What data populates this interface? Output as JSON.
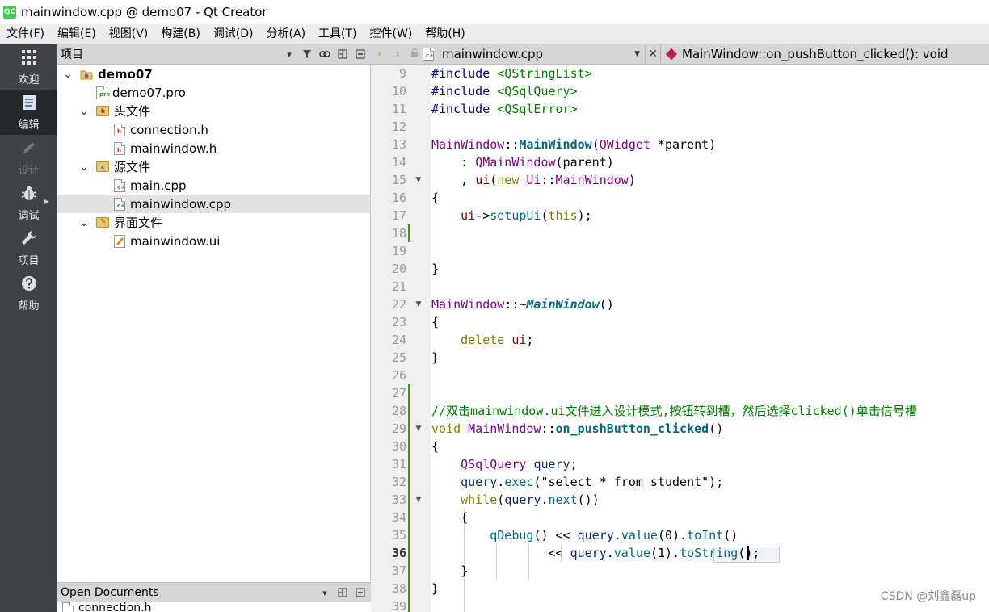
{
  "window": {
    "title": "mainwindow.cpp @ demo07 - Qt Creator",
    "logo": "QC"
  },
  "menu": [
    "文件(F)",
    "编辑(E)",
    "视图(V)",
    "构建(B)",
    "调试(D)",
    "分析(A)",
    "工具(T)",
    "控件(W)",
    "帮助(H)"
  ],
  "modes": [
    {
      "label": "欢迎",
      "icon": "grid-icon",
      "state": "normal"
    },
    {
      "label": "编辑",
      "icon": "document-icon",
      "state": "active"
    },
    {
      "label": "设计",
      "icon": "pencil-icon",
      "state": "disabled"
    },
    {
      "label": "调试",
      "icon": "bug-icon",
      "state": "normal"
    },
    {
      "label": "项目",
      "icon": "wrench-icon",
      "state": "normal"
    },
    {
      "label": "帮助",
      "icon": "help-icon",
      "state": "normal"
    }
  ],
  "project_panel": {
    "title": "项目",
    "tree": [
      {
        "label": "demo07",
        "depth": 0,
        "expanded": true,
        "icon": "project-icon",
        "bold": true
      },
      {
        "label": "demo07.pro",
        "depth": 1,
        "icon": "pro-file-icon",
        "tag": "pro"
      },
      {
        "label": "头文件",
        "depth": 1,
        "expanded": true,
        "icon": "folder-icon",
        "tag": "h"
      },
      {
        "label": "connection.h",
        "depth": 2,
        "icon": "header-file-icon",
        "tag": "h"
      },
      {
        "label": "mainwindow.h",
        "depth": 2,
        "icon": "header-file-icon",
        "tag": "h"
      },
      {
        "label": "源文件",
        "depth": 1,
        "expanded": true,
        "icon": "folder-icon",
        "tag": "c"
      },
      {
        "label": "main.cpp",
        "depth": 2,
        "icon": "cpp-file-icon",
        "tag": "c+"
      },
      {
        "label": "mainwindow.cpp",
        "depth": 2,
        "icon": "cpp-file-icon",
        "tag": "c+",
        "selected": true
      },
      {
        "label": "界面文件",
        "depth": 1,
        "expanded": true,
        "icon": "folder-icon",
        "tag": ""
      },
      {
        "label": "mainwindow.ui",
        "depth": 2,
        "icon": "ui-file-icon",
        "tag": ""
      }
    ]
  },
  "open_documents": {
    "title": "Open Documents",
    "items": [
      "connection.h"
    ]
  },
  "editor": {
    "file": "mainwindow.cpp",
    "symbol": "MainWindow::on_pushButton_clicked(): void",
    "current_line": 36,
    "lines": [
      {
        "n": 9,
        "t": [
          [
            "#include ",
            "k"
          ],
          [
            "<QStringList>",
            "s"
          ]
        ]
      },
      {
        "n": 10,
        "t": [
          [
            "#include ",
            "k"
          ],
          [
            "<QSqlQuery>",
            "s"
          ]
        ]
      },
      {
        "n": 11,
        "t": [
          [
            "#include ",
            "k"
          ],
          [
            "<QSqlError>",
            "s"
          ]
        ]
      },
      {
        "n": 12,
        "t": []
      },
      {
        "n": 13,
        "t": [
          [
            "MainWindow",
            "p"
          ],
          [
            "::",
            "d"
          ],
          [
            "MainWindow",
            "fb"
          ],
          [
            "(",
            "d"
          ],
          [
            "QWidget",
            "p"
          ],
          [
            " *parent)",
            "d"
          ]
        ]
      },
      {
        "n": 14,
        "t": [
          [
            "    : ",
            "d"
          ],
          [
            "QMainWindow",
            "p"
          ],
          [
            "(parent)",
            "d"
          ]
        ]
      },
      {
        "n": 15,
        "t": [
          [
            "    , ",
            "d"
          ],
          [
            "ui",
            "m"
          ],
          [
            "(",
            "d"
          ],
          [
            "new",
            "y"
          ],
          [
            " ",
            "d"
          ],
          [
            "Ui",
            "p"
          ],
          [
            "::",
            "d"
          ],
          [
            "MainWindow",
            "p"
          ],
          [
            ")",
            "d"
          ]
        ]
      },
      {
        "n": 16,
        "t": [
          [
            "{",
            "d"
          ]
        ]
      },
      {
        "n": 17,
        "t": [
          [
            "    ",
            "d"
          ],
          [
            "ui",
            "m"
          ],
          [
            "->",
            "d"
          ],
          [
            "setupUi",
            "f"
          ],
          [
            "(",
            "d"
          ],
          [
            "this",
            "y"
          ],
          [
            ");",
            "d"
          ]
        ]
      },
      {
        "n": 18,
        "t": []
      },
      {
        "n": 19,
        "t": []
      },
      {
        "n": 20,
        "t": [
          [
            "}",
            "d"
          ]
        ]
      },
      {
        "n": 21,
        "t": []
      },
      {
        "n": 22,
        "t": [
          [
            "MainWindow",
            "p"
          ],
          [
            "::~",
            "d"
          ],
          [
            "MainWindow",
            "fbi"
          ],
          [
            "()",
            "d"
          ]
        ]
      },
      {
        "n": 23,
        "t": [
          [
            "{",
            "d"
          ]
        ]
      },
      {
        "n": 24,
        "t": [
          [
            "    ",
            "d"
          ],
          [
            "delete",
            "y"
          ],
          [
            " ",
            "d"
          ],
          [
            "ui",
            "m"
          ],
          [
            ";",
            "d"
          ]
        ]
      },
      {
        "n": 25,
        "t": [
          [
            "}",
            "d"
          ]
        ]
      },
      {
        "n": 26,
        "t": []
      },
      {
        "n": 27,
        "t": []
      },
      {
        "n": 28,
        "t": [
          [
            "//双击mainwindow.ui文件进入设计模式,按钮转到槽，然后选择clicked()单击信号槽",
            "c"
          ]
        ]
      },
      {
        "n": 29,
        "t": [
          [
            "void",
            "y"
          ],
          [
            " ",
            "d"
          ],
          [
            "MainWindow",
            "p"
          ],
          [
            "::",
            "d"
          ],
          [
            "on_pushButton_clicked",
            "fb"
          ],
          [
            "()",
            "d"
          ]
        ]
      },
      {
        "n": 30,
        "t": [
          [
            "{",
            "d"
          ]
        ]
      },
      {
        "n": 31,
        "t": [
          [
            "    ",
            "d"
          ],
          [
            "QSqlQuery",
            "p"
          ],
          [
            " ",
            "d"
          ],
          [
            "query",
            "v"
          ],
          [
            ";",
            "d"
          ]
        ]
      },
      {
        "n": 32,
        "t": [
          [
            "    ",
            "d"
          ],
          [
            "query",
            "v"
          ],
          [
            ".",
            "d"
          ],
          [
            "exec",
            "f"
          ],
          [
            "(\"select * from student\");",
            "d"
          ]
        ]
      },
      {
        "n": 33,
        "t": [
          [
            "    ",
            "d"
          ],
          [
            "while",
            "y"
          ],
          [
            "(",
            "d"
          ],
          [
            "query",
            "v"
          ],
          [
            ".",
            "d"
          ],
          [
            "next",
            "f"
          ],
          [
            "())",
            "d"
          ]
        ]
      },
      {
        "n": 34,
        "t": [
          [
            "    {",
            "d"
          ]
        ]
      },
      {
        "n": 35,
        "t": [
          [
            "        ",
            "d"
          ],
          [
            "qDebug",
            "f"
          ],
          [
            "() << ",
            "d"
          ],
          [
            "query",
            "v"
          ],
          [
            ".",
            "d"
          ],
          [
            "value",
            "f"
          ],
          [
            "(0).",
            "d"
          ],
          [
            "toInt",
            "f"
          ],
          [
            "()",
            "d"
          ]
        ]
      },
      {
        "n": 36,
        "t": [
          [
            "                ",
            "d"
          ],
          [
            "<< ",
            "d"
          ],
          [
            "query",
            "v"
          ],
          [
            ".",
            "d"
          ],
          [
            "value",
            "f"
          ],
          [
            "(1).",
            "d"
          ],
          [
            "toString",
            "f"
          ],
          [
            "();",
            "d"
          ]
        ]
      },
      {
        "n": 37,
        "t": [
          [
            "    }",
            "d"
          ]
        ]
      },
      {
        "n": 38,
        "t": [
          [
            "}",
            "d"
          ]
        ]
      },
      {
        "n": 39,
        "t": []
      }
    ],
    "folds": [
      15,
      22,
      29,
      33
    ],
    "modified_ranges": [
      [
        18,
        18
      ],
      [
        27,
        39
      ]
    ]
  },
  "watermark": "CSDN @刘鑫磊up",
  "colors": {
    "k": "#000080",
    "s": "#008000",
    "p": "#800080",
    "fb": "#00677c",
    "fbi": "#00677c",
    "f": "#00677c",
    "y": "#808000",
    "m": "#800000",
    "v": "#092e64",
    "c": "#008000",
    "d": "#000000"
  }
}
